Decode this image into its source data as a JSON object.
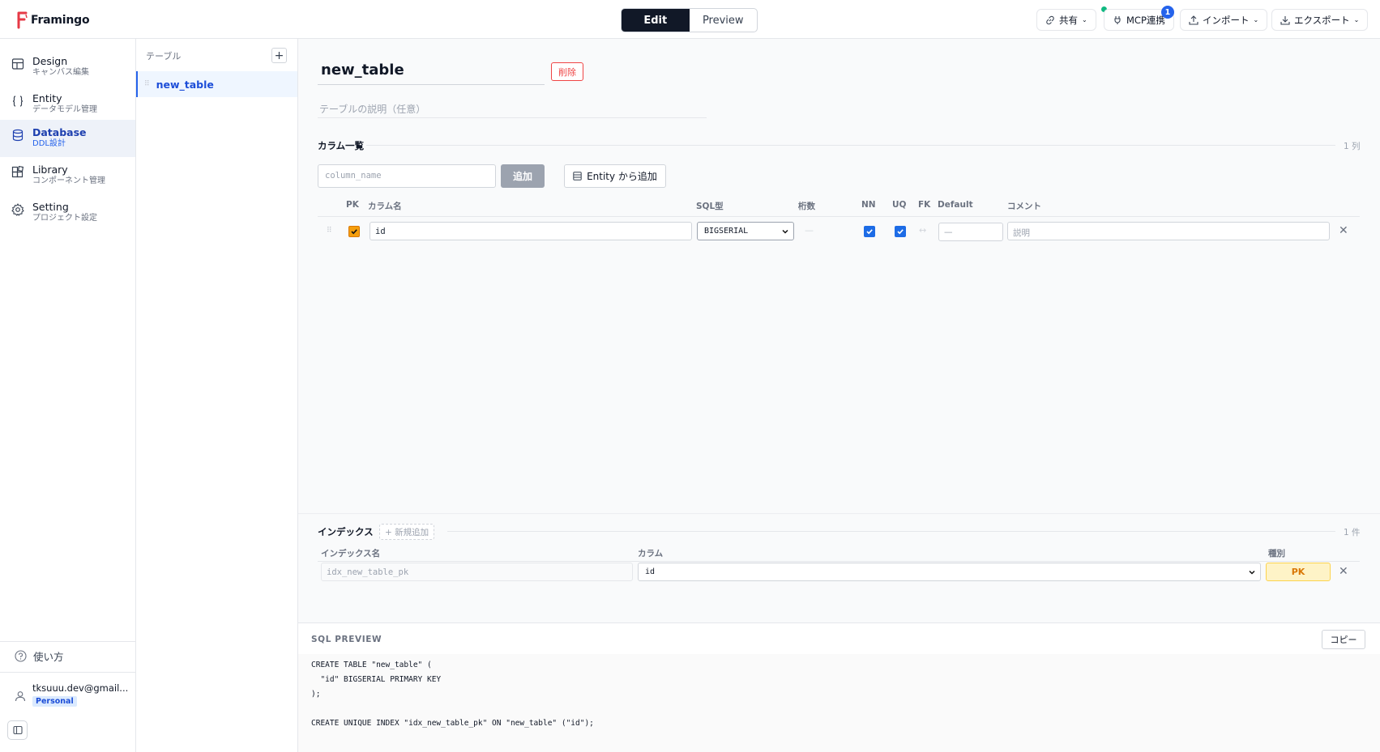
{
  "app": {
    "name": "Framingo"
  },
  "header": {
    "modes": [
      {
        "label": "Edit",
        "active": true
      },
      {
        "label": "Preview",
        "active": false
      }
    ],
    "share_label": "共有",
    "mcp_label": "MCP連携",
    "mcp_badge": "1",
    "import_label": "インポート",
    "export_label": "エクスポート"
  },
  "sidebar": {
    "items": [
      {
        "title": "Design",
        "sub": "キャンバス編集",
        "icon": "layout-icon"
      },
      {
        "title": "Entity",
        "sub": "データモデル管理",
        "icon": "braces-icon"
      },
      {
        "title": "Database",
        "sub": "DDL設計",
        "icon": "database-icon",
        "active": true
      },
      {
        "title": "Library",
        "sub": "コンポーネント管理",
        "icon": "blocks-icon"
      },
      {
        "title": "Setting",
        "sub": "プロジェクト設定",
        "icon": "gear-icon"
      }
    ],
    "help_label": "使い方",
    "user_email": "tksuuu.dev@gmail...",
    "user_plan": "Personal"
  },
  "tables_panel": {
    "title": "テーブル",
    "items": [
      {
        "name": "new_table",
        "selected": true
      }
    ]
  },
  "table": {
    "name": "new_table",
    "delete_label": "削除",
    "description_placeholder": "テーブルの説明（任意）"
  },
  "columns": {
    "section_title": "カラム一覧",
    "count": "1 列",
    "input_placeholder": "column_name",
    "add_label": "追加",
    "entity_add_label": "Entity から追加",
    "headers": {
      "pk": "PK",
      "name": "カラム名",
      "sql_type": "SQL型",
      "digits": "桁数",
      "nn": "NN",
      "uq": "UQ",
      "fk": "FK",
      "default": "Default",
      "comment": "コメント"
    },
    "rows": [
      {
        "pk": true,
        "name": "id",
        "sql_type": "BIGSERIAL",
        "digits": "—",
        "nn": true,
        "uq": true,
        "fk": "↔",
        "default_placeholder": "—",
        "comment_placeholder": "説明"
      }
    ]
  },
  "indexes": {
    "section_title": "インデックス",
    "new_add_label": "+ 新規追加",
    "count": "1 件",
    "headers": {
      "name": "インデックス名",
      "column": "カラム",
      "type": "種別"
    },
    "rows": [
      {
        "name_placeholder": "idx_new_table_pk",
        "column": "id",
        "type": "PK"
      }
    ]
  },
  "sql_preview": {
    "title": "SQL PREVIEW",
    "copy_label": "コピー",
    "lines": [
      "CREATE TABLE \"new_table\" (",
      "  \"id\" BIGSERIAL PRIMARY KEY",
      ");",
      "",
      "CREATE UNIQUE INDEX \"idx_new_table_pk\" ON \"new_table\" (\"id\");"
    ]
  },
  "colors": {
    "accent": "#2563eb",
    "primary_dark": "#111827",
    "danger": "#ef4444",
    "pk": "#f59e0b"
  }
}
